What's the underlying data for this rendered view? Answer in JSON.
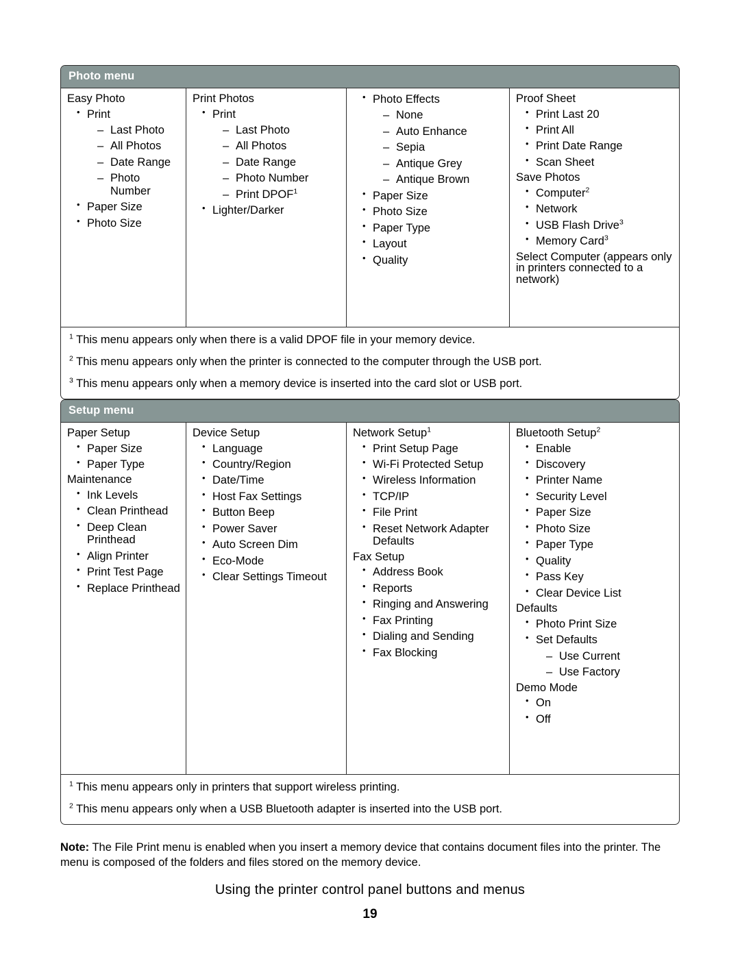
{
  "theme": {
    "header_bg": "#879695",
    "header_text": "#ffffff",
    "border": "#2b2b2b",
    "page_bg": "#ffffff",
    "body_text": "#000000"
  },
  "photo_table": {
    "header": "Photo menu",
    "columns": [
      {
        "name": "easy-photo",
        "groups": [
          {
            "title": "Easy Photo",
            "items": [
              {
                "label": "Print",
                "sub": [
                  "Last Photo",
                  "All Photos",
                  "Date Range",
                  "Photo Number"
                ]
              },
              {
                "label": "Paper Size"
              },
              {
                "label": "Photo Size"
              }
            ]
          }
        ]
      },
      {
        "name": "print-photos",
        "groups": [
          {
            "title": "Print Photos",
            "items": [
              {
                "label": "Print",
                "sub": [
                  "Last Photo",
                  "All Photos",
                  "Date Range",
                  "Photo Number",
                  "Print DPOF"
                ],
                "sub_sup": [
                  "",
                  "",
                  "",
                  "",
                  "1"
                ]
              },
              {
                "label": "Lighter/Darker"
              }
            ]
          }
        ]
      },
      {
        "name": "photo-effects",
        "groups": [
          {
            "title": "",
            "items": [
              {
                "label": "Photo Effects",
                "sub": [
                  "None",
                  "Auto Enhance",
                  "Sepia",
                  "Antique Grey",
                  "Antique Brown"
                ]
              },
              {
                "label": "Paper Size"
              },
              {
                "label": "Photo Size"
              },
              {
                "label": "Paper Type"
              },
              {
                "label": "Layout"
              },
              {
                "label": "Quality"
              }
            ]
          }
        ]
      },
      {
        "name": "proof-sheet",
        "groups": [
          {
            "title": "Proof Sheet",
            "items": [
              {
                "label": "Print Last 20"
              },
              {
                "label": "Print All"
              },
              {
                "label": "Print Date Range"
              },
              {
                "label": "Scan Sheet"
              }
            ]
          },
          {
            "title": "Save Photos",
            "items": [
              {
                "label": "Computer",
                "sup": "2"
              },
              {
                "label": "Network"
              },
              {
                "label": "USB Flash Drive",
                "sup": "3",
                "sup_space": true
              },
              {
                "label": "Memory Card",
                "sup": "3",
                "sup_space": true
              }
            ]
          },
          {
            "title": "Select Computer (appears only in printers connected to a network)",
            "items": []
          }
        ]
      }
    ],
    "footnotes": [
      {
        "marker": "1",
        "text": "This menu appears only when there is a valid DPOF file in your memory device."
      },
      {
        "marker": "2",
        "text": "This menu appears only when the printer is connected to the computer through the USB port."
      },
      {
        "marker": "3",
        "text": "This menu appears only when a memory device is inserted into the card slot or USB port."
      }
    ]
  },
  "setup_table": {
    "header": "Setup menu",
    "columns": [
      {
        "name": "paper-setup",
        "groups": [
          {
            "title": "Paper Setup",
            "items": [
              {
                "label": "Paper Size"
              },
              {
                "label": "Paper Type"
              }
            ]
          },
          {
            "title": "Maintenance",
            "items": [
              {
                "label": "Ink Levels"
              },
              {
                "label": "Clean Printhead"
              },
              {
                "label": "Deep Clean Printhead"
              },
              {
                "label": "Align Printer"
              },
              {
                "label": "Print Test Page"
              },
              {
                "label": "Replace Printhead"
              }
            ]
          }
        ]
      },
      {
        "name": "device-setup",
        "groups": [
          {
            "title": "Device Setup",
            "items": [
              {
                "label": "Language"
              },
              {
                "label": "Country/Region"
              },
              {
                "label": "Date/Time"
              },
              {
                "label": "Host Fax Settings"
              },
              {
                "label": "Button Beep"
              },
              {
                "label": "Power Saver"
              },
              {
                "label": "Auto Screen Dim"
              },
              {
                "label": "Eco-Mode"
              },
              {
                "label": "Clear Settings Timeout"
              }
            ]
          }
        ]
      },
      {
        "name": "network-setup",
        "groups": [
          {
            "title": "Network Setup",
            "title_sup": "1",
            "items": [
              {
                "label": "Print Setup Page"
              },
              {
                "label": "Wi-Fi Protected Setup"
              },
              {
                "label": "Wireless Information"
              },
              {
                "label": "TCP/IP"
              },
              {
                "label": "File Print"
              },
              {
                "label": "Reset Network Adapter Defaults"
              }
            ]
          },
          {
            "title": "Fax Setup",
            "items": [
              {
                "label": "Address Book"
              },
              {
                "label": "Reports"
              },
              {
                "label": "Ringing and Answering"
              },
              {
                "label": "Fax Printing"
              },
              {
                "label": "Dialing and Sending"
              },
              {
                "label": "Fax Blocking"
              }
            ]
          }
        ]
      },
      {
        "name": "bluetooth-setup",
        "groups": [
          {
            "title": "Bluetooth Setup",
            "title_sup": "2",
            "items": [
              {
                "label": "Enable"
              },
              {
                "label": "Discovery"
              },
              {
                "label": "Printer Name"
              },
              {
                "label": "Security Level"
              },
              {
                "label": "Paper Size"
              },
              {
                "label": "Photo Size"
              },
              {
                "label": "Paper Type"
              },
              {
                "label": "Quality"
              },
              {
                "label": "Pass Key"
              },
              {
                "label": "Clear Device List"
              }
            ]
          },
          {
            "title": "Defaults",
            "items": [
              {
                "label": "Photo Print Size"
              },
              {
                "label": "Set Defaults",
                "sub": [
                  "Use Current",
                  "Use Factory"
                ]
              }
            ]
          },
          {
            "title": "Demo Mode",
            "items": [
              {
                "label": "On"
              },
              {
                "label": "Off"
              }
            ]
          }
        ]
      }
    ],
    "footnotes": [
      {
        "marker": "1",
        "text": "This menu appears only in printers that support wireless printing."
      },
      {
        "marker": "2",
        "text": "This menu appears only when a USB Bluetooth adapter is inserted into the USB port."
      }
    ]
  },
  "note": {
    "label": "Note:",
    "text": " The File Print menu is enabled when you insert a memory device that contains document files into the printer. The menu is composed of the folders and files stored on the memory device."
  },
  "footer": {
    "title": "Using the printer control panel buttons and menus",
    "page_number": "19"
  }
}
